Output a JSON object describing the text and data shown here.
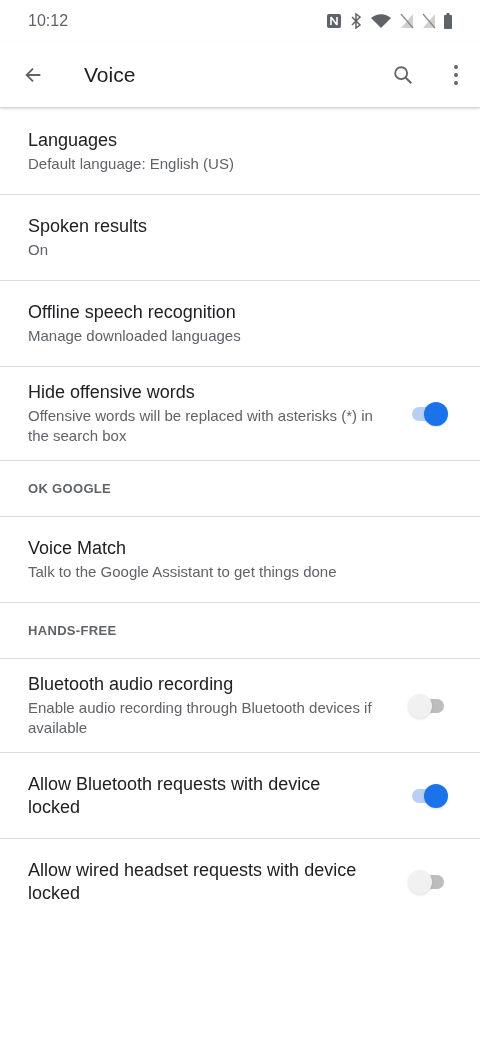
{
  "status_bar": {
    "time": "10:12"
  },
  "app_bar": {
    "title": "Voice"
  },
  "rows": [
    {
      "kind": "item",
      "title": "Languages",
      "summary": "Default language: English (US)"
    },
    {
      "kind": "item",
      "title": "Spoken results",
      "summary": "On"
    },
    {
      "kind": "item",
      "title": "Offline speech recognition",
      "summary": "Manage downloaded languages"
    },
    {
      "kind": "switch",
      "title": "Hide offensive words",
      "summary": "Offensive words will be replaced with asterisks (*) in the search box",
      "on": true
    },
    {
      "kind": "header",
      "title": "OK GOOGLE"
    },
    {
      "kind": "item",
      "title": "Voice Match",
      "summary": "Talk to the Google Assistant to get things done"
    },
    {
      "kind": "header",
      "title": "HANDS-FREE"
    },
    {
      "kind": "switch",
      "title": "Bluetooth audio recording",
      "summary": "Enable audio recording through Bluetooth devices if available",
      "on": false
    },
    {
      "kind": "switch",
      "title": "Allow Bluetooth requests with device locked",
      "on": true
    },
    {
      "kind": "switch",
      "title": "Allow wired headset requests with device locked",
      "on": false
    }
  ]
}
